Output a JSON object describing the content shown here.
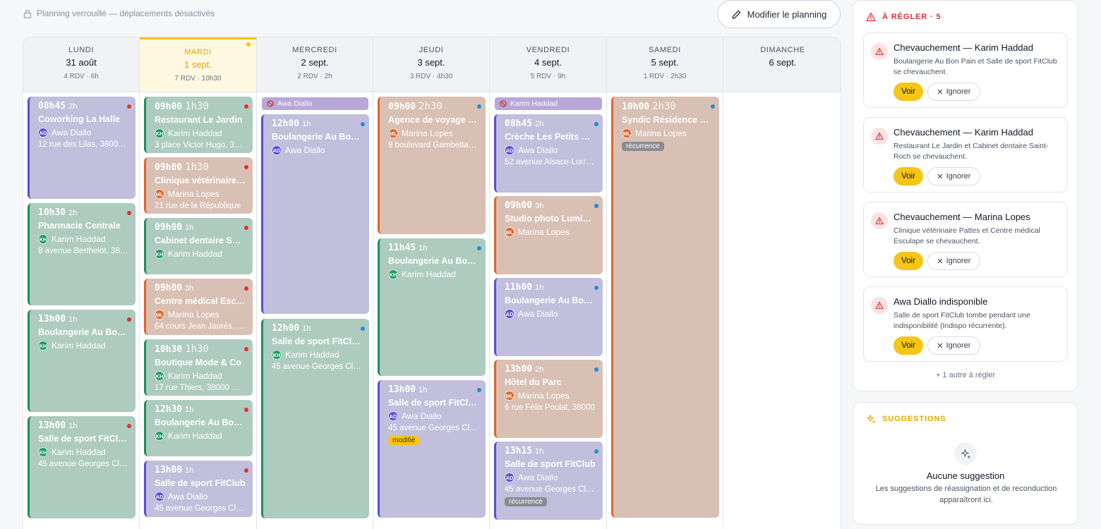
{
  "header": {
    "lock_note": "Planning verrouillé — déplacements désactivés",
    "edit_button": "Modifier le planning"
  },
  "days": [
    {
      "name": "LUNDI",
      "date": "31 août",
      "rdv": "4 RDV",
      "hours": "6h",
      "today": false
    },
    {
      "name": "MARDI",
      "date": "1 sept.",
      "rdv": "7 RDV",
      "hours": "10h30",
      "today": true
    },
    {
      "name": "MERCREDI",
      "date": "2 sept.",
      "rdv": "2 RDV",
      "hours": "2h",
      "today": false
    },
    {
      "name": "JEUDI",
      "date": "3 sept.",
      "rdv": "3 RDV",
      "hours": "4h30",
      "today": false
    },
    {
      "name": "VENDREDI",
      "date": "4 sept.",
      "rdv": "5 RDV",
      "hours": "9h",
      "today": false
    },
    {
      "name": "SAMEDI",
      "date": "5 sept.",
      "rdv": "1 RDV",
      "hours": "2h30",
      "today": false
    },
    {
      "name": "DIMANCHE",
      "date": "6 sept.",
      "rdv": "",
      "hours": "",
      "today": false
    }
  ],
  "unavailabilities": [
    {
      "day": 2,
      "person": "Awa Diallo"
    },
    {
      "day": 4,
      "person": "Karim Haddad"
    }
  ],
  "events": [
    {
      "day": 0,
      "color": "purple",
      "time": "08h45",
      "duration": "2h",
      "title": "Coworking La Halle",
      "initials": "AD",
      "person": "Awa Diallo",
      "address": "12 rue des Lilas, 38000 Grenoble",
      "status": "red"
    },
    {
      "day": 0,
      "color": "green",
      "time": "10h30",
      "duration": "2h",
      "title": "Pharmacie Centrale",
      "initials": "KH",
      "person": "Karim Haddad",
      "address": "8 avenue Berthelot, 38000 Grenoble",
      "status": "red"
    },
    {
      "day": 0,
      "color": "green",
      "time": "13h00",
      "duration": "1h",
      "title": "Boulangerie Au Bon Pain",
      "initials": "KH",
      "person": "Karim Haddad",
      "address": "",
      "status": "red"
    },
    {
      "day": 0,
      "color": "green",
      "time": "13h00",
      "duration": "1h",
      "title": "Salle de sport FitClub",
      "initials": "KH",
      "person": "Karim Haddad",
      "address": "45 avenue Georges Clemenceau",
      "status": "red"
    },
    {
      "day": 1,
      "color": "green",
      "time": "09h00",
      "duration": "1h30",
      "title": "Restaurant Le Jardin",
      "initials": "KH",
      "person": "Karim Haddad",
      "address": "3 place Victor Hugo, 38000",
      "status": "red"
    },
    {
      "day": 1,
      "color": "orange",
      "time": "09h00",
      "duration": "1h30",
      "title": "Clinique vétérinaire Pattes",
      "initials": "ML",
      "person": "Marina Lopes",
      "address": "21 rue de la République",
      "status": "red"
    },
    {
      "day": 1,
      "color": "green",
      "time": "09h00",
      "duration": "1h",
      "title": "Cabinet dentaire Saint-Roch",
      "initials": "KH",
      "person": "Karim Haddad",
      "address": "",
      "status": "red"
    },
    {
      "day": 1,
      "color": "orange",
      "time": "09h00",
      "duration": "3h",
      "title": "Centre médical Esculape",
      "initials": "ML",
      "person": "Marina Lopes",
      "address": "64 cours Jean Jaurès, 38000",
      "status": "red"
    },
    {
      "day": 1,
      "color": "green",
      "time": "10h30",
      "duration": "1h30",
      "title": "Boutique Mode & Co",
      "initials": "KH",
      "person": "Karim Haddad",
      "address": "17 rue Thiers, 38000 Grenoble",
      "status": "red"
    },
    {
      "day": 1,
      "color": "green",
      "time": "12h30",
      "duration": "1h",
      "title": "Boulangerie Au Bon Pain",
      "initials": "KH",
      "person": "Karim Haddad",
      "address": "",
      "status": "red"
    },
    {
      "day": 1,
      "color": "purple",
      "time": "13h00",
      "duration": "1h",
      "title": "Salle de sport FitClub",
      "initials": "AD",
      "person": "Awa Diallo",
      "address": "45 avenue Georges Clemenceau",
      "status": "red"
    },
    {
      "day": 2,
      "color": "purple",
      "time": "12h00",
      "duration": "1h",
      "title": "Boulangerie Au Bon Pain",
      "initials": "AD",
      "person": "Awa Diallo",
      "address": "",
      "status": "blue"
    },
    {
      "day": 2,
      "color": "green",
      "time": "12h00",
      "duration": "1h",
      "title": "Salle de sport FitClub",
      "initials": "KH",
      "person": "Karim Haddad",
      "address": "45 avenue Georges Clemenceau",
      "status": "blue"
    },
    {
      "day": 3,
      "color": "orange",
      "time": "09h00",
      "duration": "2h30",
      "title": "Agence de voyage Horizon",
      "initials": "ML",
      "person": "Marina Lopes",
      "address": "9 boulevard Gambetta, 38000",
      "status": "blue"
    },
    {
      "day": 3,
      "color": "green",
      "time": "11h45",
      "duration": "1h",
      "title": "Boulangerie Au Bon Pain",
      "initials": "KH",
      "person": "Karim Haddad",
      "address": "",
      "status": "blue"
    },
    {
      "day": 3,
      "color": "purple",
      "time": "13h00",
      "duration": "1h",
      "title": "Salle de sport FitClub",
      "initials": "AD",
      "person": "Awa Diallo",
      "address": "45 avenue Georges Clemenceau",
      "status": "blue",
      "tag": "modifié",
      "tag_color": "yellow"
    },
    {
      "day": 4,
      "color": "purple",
      "time": "08h45",
      "duration": "2h",
      "title": "Crèche Les Petits Pas",
      "initials": "AD",
      "person": "Awa Diallo",
      "address": "52 avenue Alsace-Lorraine",
      "status": "blue"
    },
    {
      "day": 4,
      "color": "orange",
      "time": "09h00",
      "duration": "3h",
      "title": "Studio photo Lumière",
      "initials": "ML",
      "person": "Marina Lopes",
      "address": "",
      "status": "blue"
    },
    {
      "day": 4,
      "color": "purple",
      "time": "11h00",
      "duration": "1h",
      "title": "Boulangerie Au Bon Pain",
      "initials": "AD",
      "person": "Awa Diallo",
      "address": "",
      "status": "blue"
    },
    {
      "day": 4,
      "color": "orange",
      "time": "13h00",
      "duration": "2h",
      "title": "Hôtel du Parc",
      "initials": "ML",
      "person": "Marina Lopes",
      "address": "6 rue Félix Poulat, 38000",
      "status": "blue"
    },
    {
      "day": 4,
      "color": "purple",
      "time": "13h15",
      "duration": "1h",
      "title": "Salle de sport FitClub",
      "initials": "AD",
      "person": "Awa Diallo",
      "address": "45 avenue Georges Clemenceau",
      "status": "blue",
      "tag": "récurrence",
      "tag_color": "grey"
    },
    {
      "day": 5,
      "color": "orange",
      "time": "10h00",
      "duration": "2h30",
      "title": "Syndic Résidence Les Cèdres",
      "initials": "ML",
      "person": "Marina Lopes",
      "address": "",
      "status": "blue",
      "tag": "récurrence",
      "tag_color": "grey"
    }
  ],
  "alerts": {
    "heading": "À RÉGLER · 5",
    "items": [
      {
        "title": "Chevauchement — Karim Haddad",
        "desc": "Boulangerie Au Bon Pain et Salle de sport FitClub se chevauchent."
      },
      {
        "title": "Chevauchement — Karim Haddad",
        "desc": "Restaurant Le Jardin et Cabinet dentaire Saint-Roch se chevauchent."
      },
      {
        "title": "Chevauchement — Marina Lopes",
        "desc": "Clinique vétérinaire Pattes et Centre médical Esculape se chevauchent."
      },
      {
        "title": "Awa Diallo indisponible",
        "desc": "Salle de sport FitClub tombe pendant une indisponibilité (Indispo récurrente)."
      }
    ],
    "view_label": "Voir",
    "ignore_label": "Ignorer",
    "more": "+ 1 autre à régler"
  },
  "suggestions": {
    "heading": "SUGGESTIONS",
    "empty_title": "Aucune suggestion",
    "empty_desc": "Les suggestions de réassignation et de reconduction apparaîtront ici."
  },
  "colors": {
    "accent": "#f5c518",
    "danger": "#e03131",
    "awa": "#5b4fd6",
    "karim": "#1f9d63",
    "marina": "#e2642a"
  }
}
